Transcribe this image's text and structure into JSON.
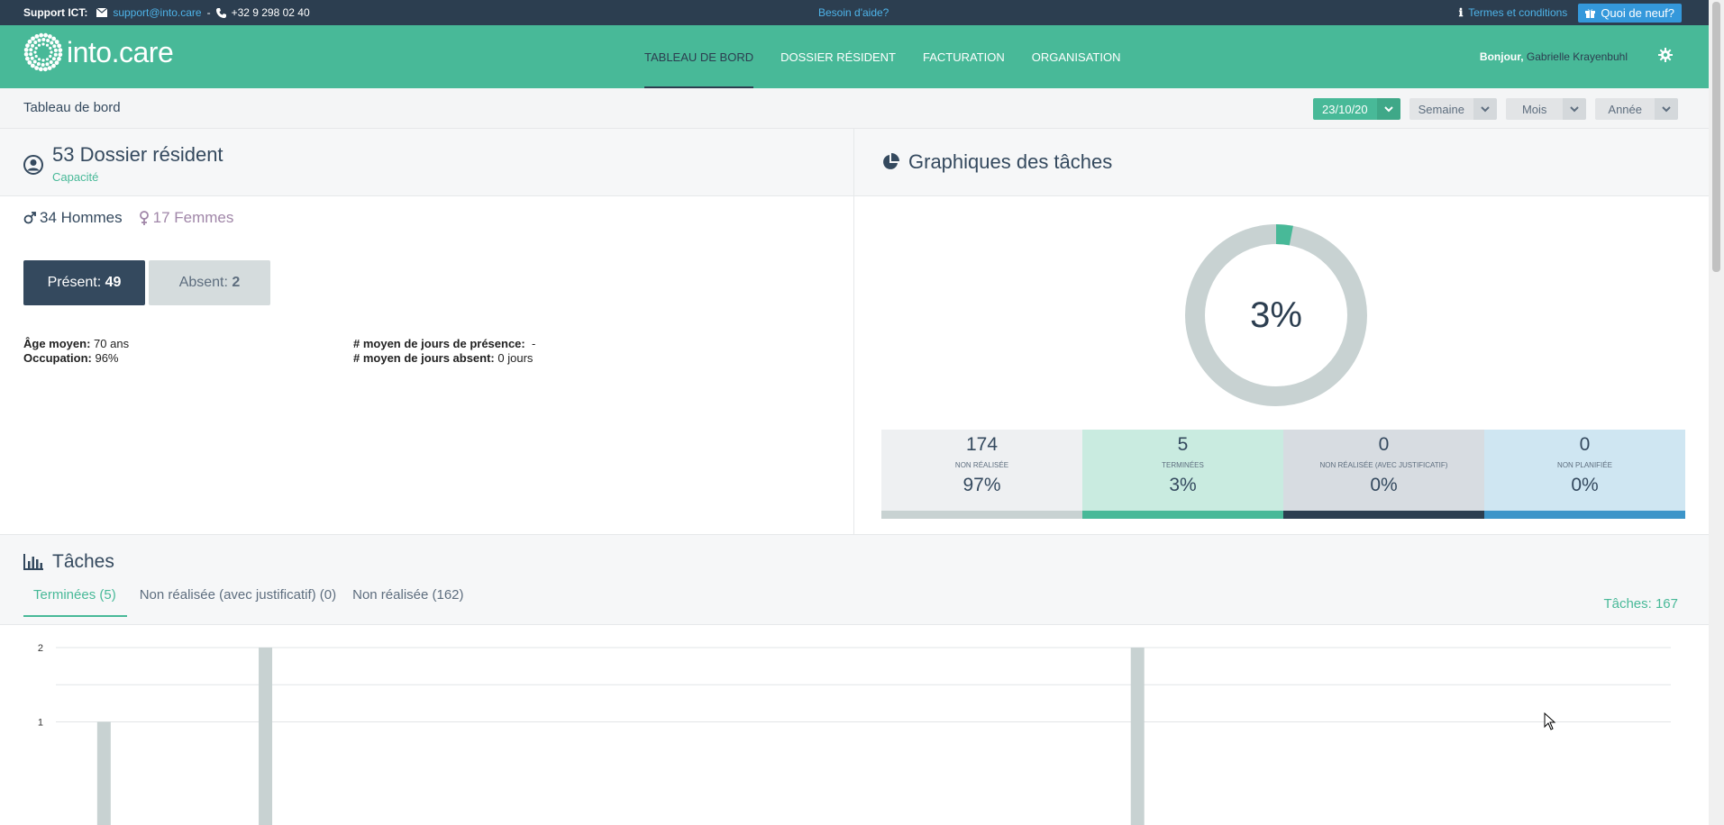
{
  "topbar": {
    "support_label": "Support ICT:",
    "email": "support@into.care",
    "separator": "-",
    "phone": "+32 9 298 02 40",
    "help": "Besoin d'aide?",
    "terms": "Termes et conditions",
    "whats_new": "Quoi de neuf?"
  },
  "nav": {
    "logo": "into.care",
    "items": [
      "TABLEAU DE BORD",
      "DOSSIER RÉSIDENT",
      "FACTURATION",
      "ORGANISATION"
    ],
    "greeting": "Bonjour,",
    "user": "Gabrielle Krayenbuhl"
  },
  "breadcrumb": "Tableau de bord",
  "filters": {
    "date": "23/10/20",
    "week": "Semaine",
    "month": "Mois",
    "year": "Année"
  },
  "residents": {
    "title": "53 Dossier résident",
    "subtitle": "Capacité",
    "men": "34 Hommes",
    "women": "17 Femmes",
    "present_label": "Présent:",
    "present_value": "49",
    "absent_label": "Absent:",
    "absent_value": "2",
    "avg_age_label": "Âge moyen:",
    "avg_age_value": "70 ans",
    "occupation_label": "Occupation:",
    "occupation_value": "96%",
    "avg_presence_label": "# moyen de jours de présence:",
    "avg_presence_value": "-",
    "avg_absence_label": "# moyen de jours absent:",
    "avg_absence_value": "0 jours"
  },
  "task_chart": {
    "title": "Graphiques des tâches",
    "donut_label": "3%",
    "donut_fraction": 0.03,
    "tiles": [
      {
        "num": "174",
        "label": "NON RÉALISÉE",
        "pct": "97%",
        "bg": "#eef0f2",
        "bar": "#c8d2d2"
      },
      {
        "num": "5",
        "label": "TERMINÉES",
        "pct": "3%",
        "bg": "#c9ebe0",
        "bar": "#48b998"
      },
      {
        "num": "0",
        "label": "NON RÉALISÉE (AVEC JUSTIFICATIF)",
        "pct": "0%",
        "bg": "#d7dce1",
        "bar": "#2c3e50"
      },
      {
        "num": "0",
        "label": "NON PLANIFIÉE",
        "pct": "0%",
        "bg": "#cfe6f2",
        "bar": "#3d95c9"
      }
    ]
  },
  "tasks": {
    "title": "Tâches",
    "tabs": [
      "Terminées (5)",
      "Non réalisée (avec justificatif) (0)",
      "Non réalisée (162)"
    ],
    "count": "Tâches: 167"
  },
  "chart_data": {
    "type": "bar",
    "y_ticks": [
      "2",
      "1"
    ],
    "ylim": [
      0,
      2
    ],
    "x": [
      0.02,
      0.12,
      0.66
    ],
    "values": [
      1,
      2,
      2
    ],
    "grid": true,
    "bar_color": "#c8d2d2"
  },
  "colors": {
    "brand": "#48b998",
    "dark": "#2c3e50",
    "link": "#4eb3e8"
  }
}
